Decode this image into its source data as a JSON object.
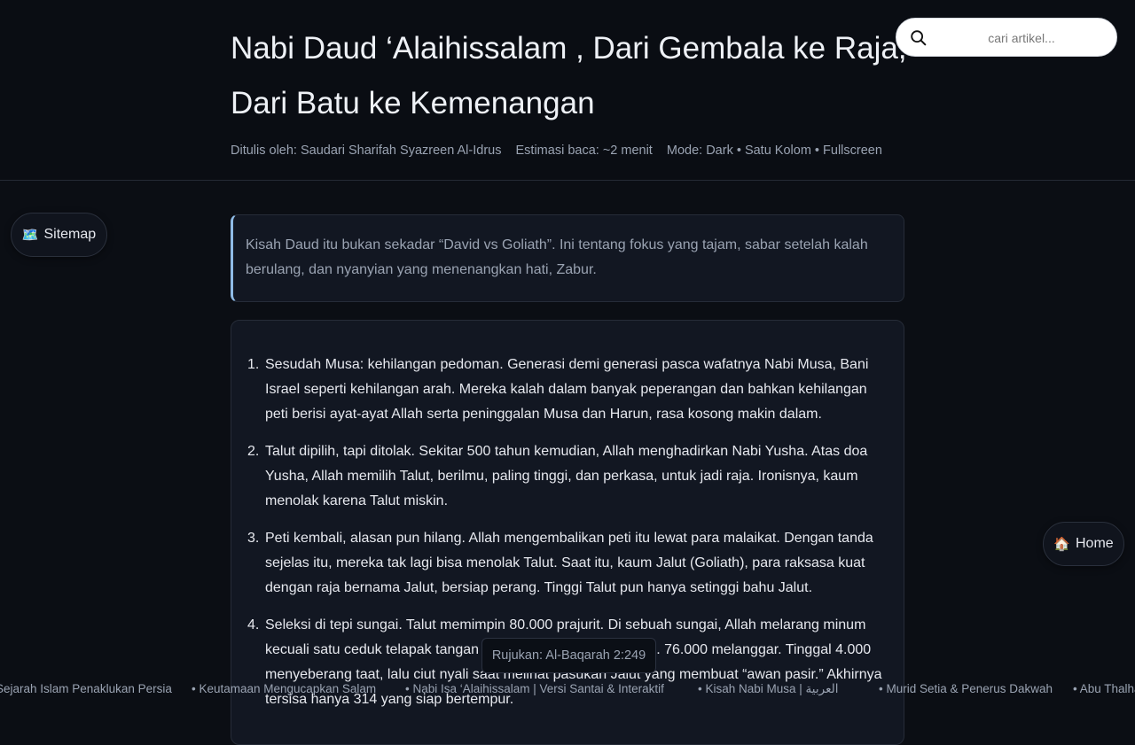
{
  "header": {
    "title_line1": "Nabi Daud ‘Alaihissalam , Dari Gembala ke Raja,",
    "title_line2": "Dari Batu ke Kemenangan",
    "author": "Ditulis oleh: Saudari Sharifah Syazreen Al-Idrus",
    "reading_time": "Estimasi baca: ~2 menit",
    "mode": "Mode: Dark • Satu Kolom • Fullscreen"
  },
  "search": {
    "placeholder": "cari artikel...",
    "icon": "search-icon"
  },
  "nav": {
    "sitemap_emoji": "🗺️",
    "sitemap_label": "Sitemap",
    "home_emoji": "🏠",
    "home_label": "Home"
  },
  "intro": "Kisah Daud itu bukan sekadar “David vs Goliath”. Ini tentang fokus yang tajam, sabar setelah kalah berulang, dan nyanyian yang menenangkan hati, Zabur.",
  "list": [
    {
      "num": "1.",
      "text": "Sesudah Musa: kehilangan pedoman. Generasi demi generasi pasca wafatnya Nabi Musa, Bani Israel seperti kehilangan arah. Mereka kalah dalam banyak peperangan dan bahkan kehilangan peti berisi ayat-ayat Allah serta peninggalan Musa dan Harun, rasa kosong makin dalam."
    },
    {
      "num": "2.",
      "text": "Talut dipilih, tapi ditolak. Sekitar 500 tahun kemudian, Allah menghadirkan Nabi Yusha. Atas doa Yusha, Allah memilih Talut, berilmu, paling tinggi, dan perkasa, untuk jadi raja. Ironisnya, kaum menolak karena Talut miskin."
    },
    {
      "num": "3.",
      "text": "Peti kembali, alasan pun hilang. Allah mengembalikan peti itu lewat para malaikat. Dengan tanda sejelas itu, mereka tak lagi bisa menolak Talut. Saat itu, kaum Jalut (Goliath), para raksasa kuat dengan raja bernama Jalut, bersiap perang. Tinggi Talut pun hanya setinggi bahu Jalut."
    },
    {
      "num": "4.",
      "text": "Seleksi di tepi sungai. Talut memimpin 80.000 prajurit. Di sebuah sungai, Allah melarang minum kecuali satu ceduk telapak tangan Rujukan: Al-Baqarah 2:249 . 76.000 melanggar. Tinggal 4.000 menyeberang taat, lalu ciut nyali saat melihat pasukan Jalut yang membuat “awan pasir.” Akhirnya tersisa hanya 314 yang siap bertempur."
    }
  ],
  "tooltip": "Rujukan: Al-Baqarah 2:249",
  "ticker": [
    "Sejarah Islam Penaklukan Persia",
    "• Keutamaan Mengucapkan Salam",
    "• Nabi Isa ‘Alaihissalam | Versi Santai & Interaktif",
    "• Kisah Nabi Musa | العربية",
    "• Murid Setia & Penerus Dakwah",
    "• Abu Thalhah"
  ]
}
